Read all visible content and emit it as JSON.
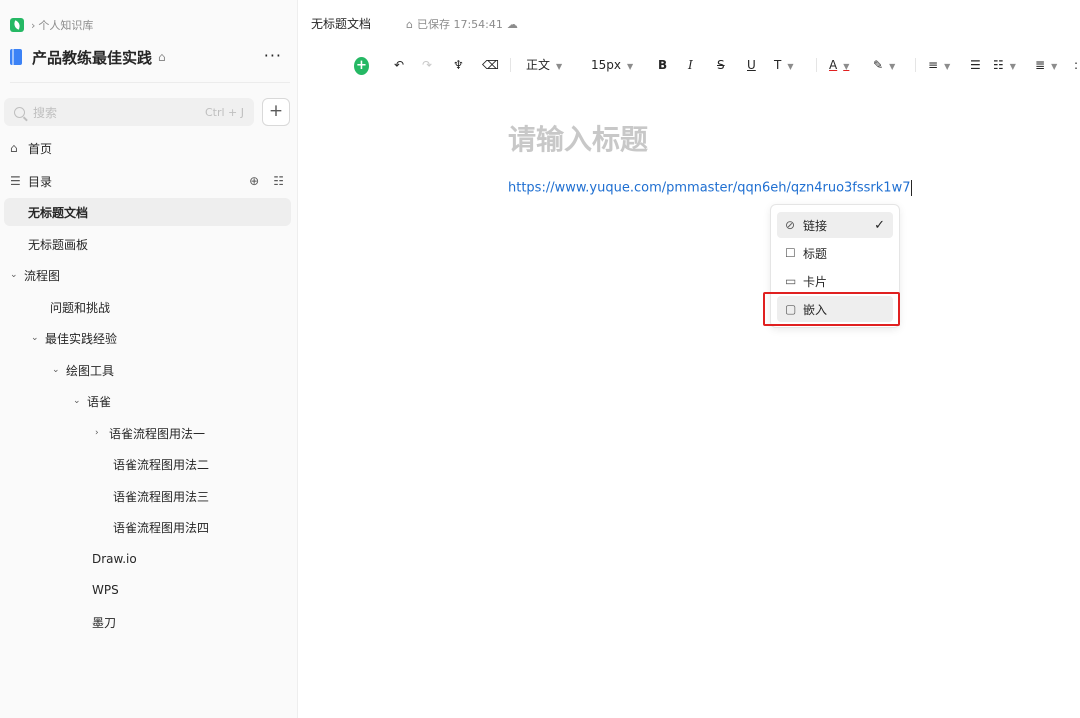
{
  "sidebar": {
    "breadcrumb": "个人知识库",
    "book_title": "产品教练最佳实践",
    "search": {
      "placeholder": "搜索",
      "shortcut": "Ctrl + J"
    },
    "nav": {
      "home": "首页",
      "toc": "目录"
    },
    "tree": [
      {
        "label": "无标题文档",
        "active": true
      },
      {
        "label": "无标题画板"
      },
      {
        "label": "流程图",
        "chevron": "⌄"
      },
      {
        "label": "问题和挑战"
      },
      {
        "label": "最佳实践经验",
        "chevron": "⌄"
      },
      {
        "label": "绘图工具",
        "chevron": "⌄"
      },
      {
        "label": "语雀",
        "chevron": "⌄"
      },
      {
        "label": "语雀流程图用法一",
        "chevron": "›"
      },
      {
        "label": "语雀流程图用法二"
      },
      {
        "label": "语雀流程图用法三"
      },
      {
        "label": "语雀流程图用法四"
      },
      {
        "label": "Draw.io"
      },
      {
        "label": "WPS"
      },
      {
        "label": "墨刀"
      }
    ]
  },
  "header": {
    "doc_tab": "无标题文档",
    "saved": "已保存 17:54:41"
  },
  "toolbar": {
    "text_style": "正文",
    "font_size": "15px",
    "bold": "B",
    "italic": "I",
    "strike": "S",
    "underline": "U",
    "font_color": "A"
  },
  "editor": {
    "title_placeholder": "请输入标题",
    "link_text": "https://www.yuque.com/pmmaster/qqn6eh/qzn4ruo3fssrk1w7"
  },
  "link_menu": {
    "options": [
      {
        "label": "链接",
        "icon": "link-icon",
        "checked": true
      },
      {
        "label": "标题",
        "icon": "title-icon"
      },
      {
        "label": "卡片",
        "icon": "card-icon"
      },
      {
        "label": "嵌入",
        "icon": "embed-icon",
        "highlighted": true
      }
    ]
  },
  "colors": {
    "accent": "#25b864",
    "link": "#1f6fd1",
    "highlight_box": "#e02020"
  }
}
